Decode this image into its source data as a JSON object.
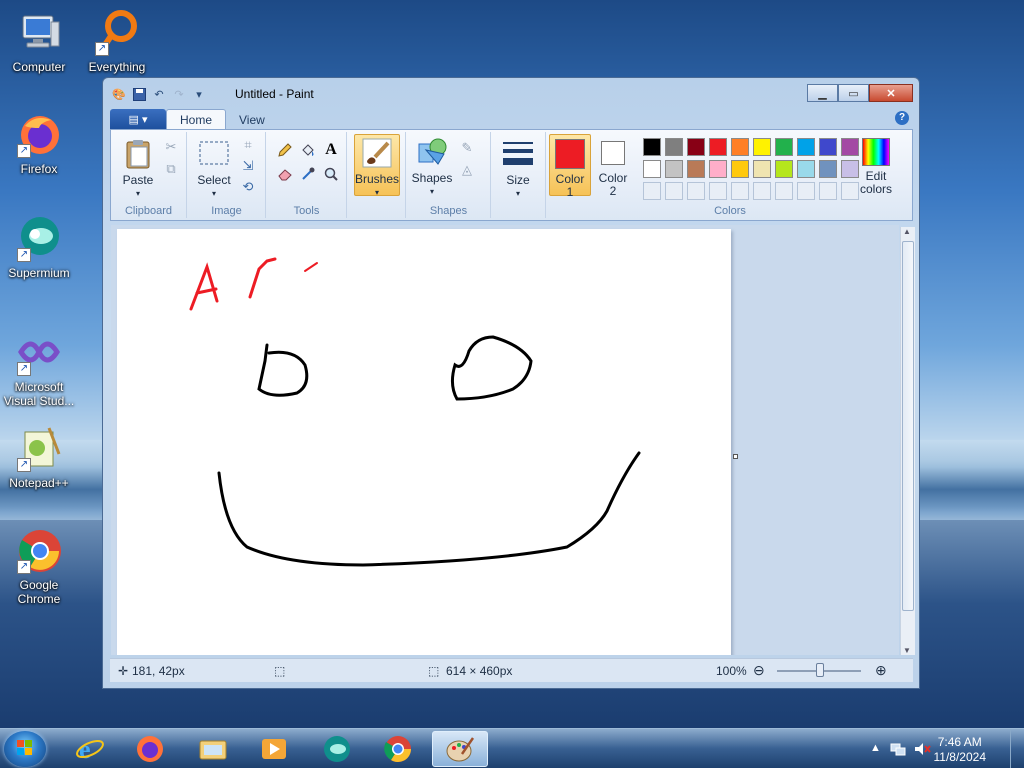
{
  "desktop": {
    "icons": [
      {
        "label": "Computer"
      },
      {
        "label": "Everything"
      },
      {
        "label": "Firefox"
      },
      {
        "label": "Supermium"
      },
      {
        "label": "Microsoft Visual Stud..."
      },
      {
        "label": "Notepad++"
      },
      {
        "label": "Google Chrome"
      }
    ]
  },
  "window": {
    "title": "Untitled - Paint",
    "tabs": [
      {
        "label": "Home"
      },
      {
        "label": "View"
      }
    ],
    "help": "?",
    "ribbon": {
      "clipboard": {
        "group_label": "Clipboard",
        "paste_label": "Paste"
      },
      "image": {
        "group_label": "Image",
        "select_label": "Select"
      },
      "tools": {
        "group_label": "Tools"
      },
      "brushes": {
        "label": "Brushes"
      },
      "shapes": {
        "group_label": "Shapes",
        "shapes_label": "Shapes"
      },
      "size": {
        "label": "Size"
      },
      "colors": {
        "group_label": "Colors",
        "color1_label": "Color 1",
        "color1_line1": "Color",
        "color1_line2": "1",
        "color2_line1": "Color",
        "color2_line2": "2",
        "color1_value": "#ed1c24",
        "color2_value": "#ffffff",
        "edit_line1": "Edit",
        "edit_line2": "colors",
        "palette_row1": [
          "#000000",
          "#7f7f7f",
          "#880015",
          "#ed1c24",
          "#ff7f27",
          "#fff200",
          "#22b14c",
          "#00a2e8",
          "#3f48cc",
          "#a349a4"
        ],
        "palette_row2": [
          "#ffffff",
          "#c3c3c3",
          "#b97a57",
          "#ffaec9",
          "#ffc90e",
          "#efe4b0",
          "#b5e61d",
          "#99d9ea",
          "#7092be",
          "#c8bfe7"
        ]
      }
    },
    "status": {
      "cursor_pos": "181, 42px",
      "canvas_size": "614 × 460px",
      "zoom": "100%"
    }
  },
  "taskbar": {
    "apps": [
      {
        "name": "Internet Explorer"
      },
      {
        "name": "Firefox"
      },
      {
        "name": "File Explorer"
      },
      {
        "name": "Media Player"
      },
      {
        "name": "Supermium"
      },
      {
        "name": "Google Chrome"
      },
      {
        "name": "Paint"
      }
    ],
    "time": "7:46 AM",
    "date": "11/8/2024"
  }
}
